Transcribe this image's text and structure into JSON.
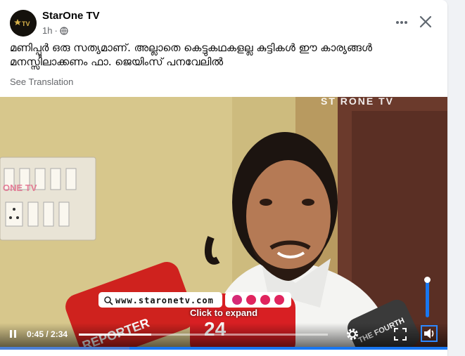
{
  "post": {
    "page_name": "StarOne TV",
    "time_ago": "1h",
    "dot": "·",
    "caption": "മണിപ്പൂർ ഒരു സത്യമാണ്. അല്ലാതെ കെട്ടുകഥകളല്ല കുട്ടികൾ ഈ കാര്യങ്ങൾ മനസ്സിലാക്കണം ഫാ. ജെയിംസ് പനവേലിൽ",
    "see_translation": "See Translation",
    "avatar_text": "TV",
    "icons": {
      "privacy": "globe-icon",
      "more": "more-icon",
      "close": "close-icon"
    }
  },
  "video": {
    "watermark": "ST RONE TV",
    "panel_watermark": "ONE TV",
    "website": "www.staronetv.com",
    "expand_hint": "Click to expand",
    "mic_labels": [
      "REPORTER",
      "24",
      "THE FOURTH"
    ],
    "controls": {
      "current_time": "0:45",
      "duration": "2:34",
      "time_separator": " / ",
      "progress": 0.29,
      "volume": 0.92
    },
    "colors": {
      "accent": "#1877f2",
      "mic_red": "#d0201d",
      "wall": "#c9b77a"
    }
  }
}
